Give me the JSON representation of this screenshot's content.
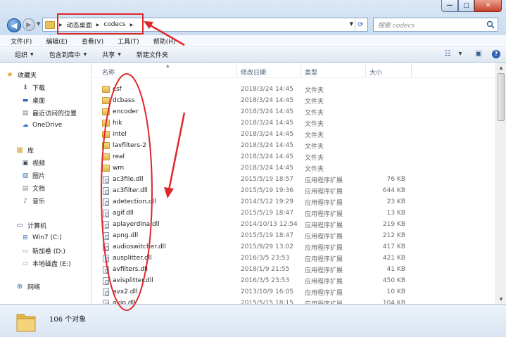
{
  "window": {
    "controls": {
      "minimize": "—",
      "maximize": "□",
      "close": "✕"
    }
  },
  "address": {
    "crumbs": [
      "动态桌面",
      "codecs"
    ],
    "search_placeholder": "搜索 codecs"
  },
  "menu": [
    "文件(F)",
    "编辑(E)",
    "查看(V)",
    "工具(T)",
    "帮助(H)"
  ],
  "toolbar": {
    "items": [
      {
        "label": "组织",
        "dropdown": true
      },
      {
        "label": "包含到库中",
        "dropdown": true
      },
      {
        "label": "共享",
        "dropdown": true
      },
      {
        "label": "新建文件夹",
        "dropdown": false
      }
    ]
  },
  "nav": {
    "favorites": {
      "label": "收藏夹",
      "items": [
        "下载",
        "桌面",
        "最近访问的位置",
        "OneDrive"
      ]
    },
    "libraries": {
      "label": "库",
      "items": [
        "视频",
        "图片",
        "文档",
        "音乐"
      ]
    },
    "computer": {
      "label": "计算机",
      "items": [
        "Win7 (C:)",
        "新加卷 (D:)",
        "本地磁盘 (E:)"
      ]
    },
    "network": {
      "label": "网络"
    }
  },
  "columns": {
    "name": "名称",
    "date": "修改日期",
    "type": "类型",
    "size": "大小"
  },
  "files": [
    {
      "name": "csf",
      "date": "2018/3/24 14:45",
      "type": "文件夹",
      "size": "",
      "kind": "folder"
    },
    {
      "name": "dcbass",
      "date": "2018/3/24 14:45",
      "type": "文件夹",
      "size": "",
      "kind": "folder"
    },
    {
      "name": "encoder",
      "date": "2018/3/24 14:45",
      "type": "文件夹",
      "size": "",
      "kind": "folder"
    },
    {
      "name": "hik",
      "date": "2018/3/24 14:45",
      "type": "文件夹",
      "size": "",
      "kind": "folder"
    },
    {
      "name": "intel",
      "date": "2018/3/24 14:45",
      "type": "文件夹",
      "size": "",
      "kind": "folder"
    },
    {
      "name": "lavfilters-2",
      "date": "2018/3/24 14:45",
      "type": "文件夹",
      "size": "",
      "kind": "folder"
    },
    {
      "name": "real",
      "date": "2018/3/24 14:45",
      "type": "文件夹",
      "size": "",
      "kind": "folder"
    },
    {
      "name": "wm",
      "date": "2018/3/24 14:45",
      "type": "文件夹",
      "size": "",
      "kind": "folder"
    },
    {
      "name": "ac3file.dll",
      "date": "2015/5/19 18:57",
      "type": "应用程序扩展",
      "size": "76 KB",
      "kind": "dll"
    },
    {
      "name": "ac3filter.dll",
      "date": "2015/5/19 19:36",
      "type": "应用程序扩展",
      "size": "644 KB",
      "kind": "dll"
    },
    {
      "name": "adetection.dll",
      "date": "2014/3/12 19:29",
      "type": "应用程序扩展",
      "size": "23 KB",
      "kind": "dll"
    },
    {
      "name": "agif.dll",
      "date": "2015/5/19 18:47",
      "type": "应用程序扩展",
      "size": "13 KB",
      "kind": "dll"
    },
    {
      "name": "aplayerdlna.dll",
      "date": "2014/10/13 12:54",
      "type": "应用程序扩展",
      "size": "219 KB",
      "kind": "dll"
    },
    {
      "name": "apng.dll",
      "date": "2015/5/19 18:47",
      "type": "应用程序扩展",
      "size": "212 KB",
      "kind": "dll"
    },
    {
      "name": "audioswitcher.dll",
      "date": "2015/9/29 13:02",
      "type": "应用程序扩展",
      "size": "417 KB",
      "kind": "dll"
    },
    {
      "name": "ausplitter.dll",
      "date": "2016/3/5 23:53",
      "type": "应用程序扩展",
      "size": "421 KB",
      "kind": "dll"
    },
    {
      "name": "avfilters.dll",
      "date": "2018/1/9 21:55",
      "type": "应用程序扩展",
      "size": "41 KB",
      "kind": "dll"
    },
    {
      "name": "avisplitter.dll",
      "date": "2016/3/5 23:53",
      "type": "应用程序扩展",
      "size": "450 KB",
      "kind": "dll"
    },
    {
      "name": "avx2.dll",
      "date": "2013/10/9 16:05",
      "type": "应用程序扩展",
      "size": "10 KB",
      "kind": "dll"
    },
    {
      "name": "axip.dll",
      "date": "2015/5/15 18:15",
      "type": "应用程序扩展",
      "size": "104 KB",
      "kind": "dll"
    }
  ],
  "status": {
    "count": "106 个对象"
  },
  "colors": {
    "annotation": "#e0262b",
    "titlebar": "#c9dcf1",
    "folder": "#e3b548"
  }
}
